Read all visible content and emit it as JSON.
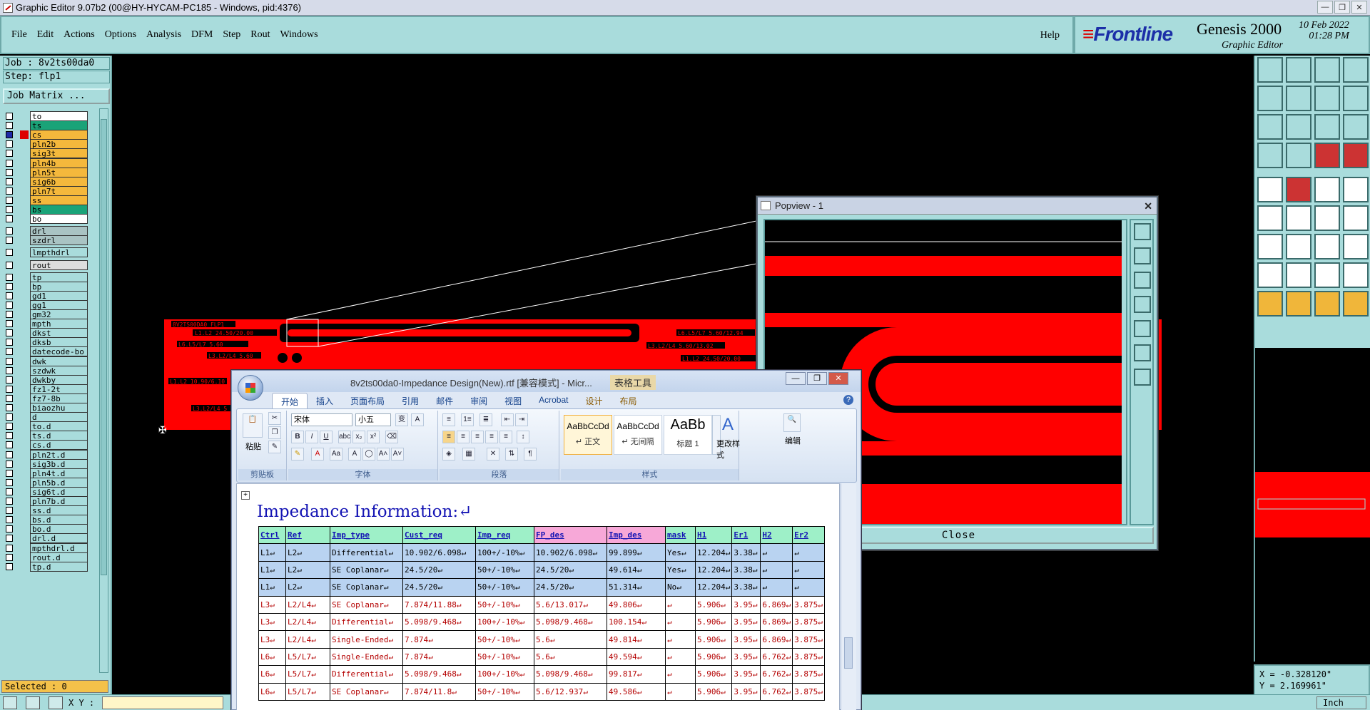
{
  "window": {
    "title": "Graphic Editor 9.07b2 (00@HY-HYCAM-PC185 - Windows, pid:4376)"
  },
  "menu": {
    "items": [
      "File",
      "Edit",
      "Actions",
      "Options",
      "Analysis",
      "DFM",
      "Step",
      "Rout",
      "Windows"
    ],
    "help": "Help"
  },
  "brand": {
    "logo": "Frontline",
    "product": "Genesis 2000",
    "subtitle": "Graphic Editor",
    "date": "10 Feb 2022",
    "time": "01:28 PM"
  },
  "job": {
    "job": "Job : 8v2ts00da0",
    "step": "Step: flp1",
    "matrix_button": "Job Matrix ...",
    "selected": "Selected : 0"
  },
  "layers": [
    {
      "name": "to",
      "color": "#ffffff"
    },
    {
      "name": "ts",
      "color": "#1aa378"
    },
    {
      "name": "cs",
      "color": "#f4b83c",
      "sel": true
    },
    {
      "name": "pln2b",
      "color": "#f4b83c"
    },
    {
      "name": "sig3t",
      "color": "#f4b83c"
    },
    {
      "name": "pln4b",
      "color": "#f4b83c"
    },
    {
      "name": "pln5t",
      "color": "#f4b83c"
    },
    {
      "name": "sig6b",
      "color": "#f4b83c"
    },
    {
      "name": "pln7t",
      "color": "#f4b83c"
    },
    {
      "name": "ss",
      "color": "#f4b83c"
    },
    {
      "name": "bs",
      "color": "#1aa378"
    },
    {
      "name": "bo",
      "color": "#ffffff"
    },
    {
      "name": "drl",
      "color": "#a9c3c3",
      "gap": true
    },
    {
      "name": "szdrl",
      "color": "#a9c3c3"
    },
    {
      "name": "lmpthdrl",
      "color": "#a9dcdc",
      "gap": true
    },
    {
      "name": "rout",
      "color": "#dddddd",
      "gap": true
    },
    {
      "name": "tp",
      "color": "#a9dcdc",
      "gap": true
    },
    {
      "name": "bp",
      "color": "#a9dcdc"
    },
    {
      "name": "gd1",
      "color": "#a9dcdc"
    },
    {
      "name": "gg1",
      "color": "#a9dcdc"
    },
    {
      "name": "gm32",
      "color": "#a9dcdc"
    },
    {
      "name": "mpth",
      "color": "#a9dcdc"
    },
    {
      "name": "dkst",
      "color": "#a9dcdc"
    },
    {
      "name": "dksb",
      "color": "#a9dcdc"
    },
    {
      "name": "datecode-bo",
      "color": "#a9dcdc"
    },
    {
      "name": "dwk",
      "color": "#a9dcdc"
    },
    {
      "name": "szdwk",
      "color": "#a9dcdc"
    },
    {
      "name": "dwkby",
      "color": "#a9dcdc"
    },
    {
      "name": "fz1-2t",
      "color": "#a9dcdc"
    },
    {
      "name": "fz7-8b",
      "color": "#a9dcdc"
    },
    {
      "name": "biaozhu",
      "color": "#a9dcdc"
    },
    {
      "name": "d",
      "color": "#a9dcdc"
    },
    {
      "name": "to.d",
      "color": "#a9dcdc"
    },
    {
      "name": "ts.d",
      "color": "#a9dcdc"
    },
    {
      "name": "cs.d",
      "color": "#a9dcdc"
    },
    {
      "name": "pln2t.d",
      "color": "#a9dcdc"
    },
    {
      "name": "sig3b.d",
      "color": "#a9dcdc"
    },
    {
      "name": "pln4t.d",
      "color": "#a9dcdc"
    },
    {
      "name": "pln5b.d",
      "color": "#a9dcdc"
    },
    {
      "name": "sig6t.d",
      "color": "#a9dcdc"
    },
    {
      "name": "pln7b.d",
      "color": "#a9dcdc"
    },
    {
      "name": "ss.d",
      "color": "#a9dcdc"
    },
    {
      "name": "bs.d",
      "color": "#a9dcdc"
    },
    {
      "name": "bo.d",
      "color": "#a9dcdc"
    },
    {
      "name": "drl.d",
      "color": "#a9dcdc"
    },
    {
      "name": "mpthdrl.d",
      "color": "#a9dcdc"
    },
    {
      "name": "rout.d",
      "color": "#a9dcdc"
    },
    {
      "name": "tp.d",
      "color": "#a9dcdc"
    }
  ],
  "board": {
    "label": "8V2TS00DA0 FLP1",
    "texts": [
      "L1.L2 24.50/20.00",
      "L6.L5/L7 5.60/12.94",
      "L6.L5/L7 5.60",
      "L3.L2/L4 5.60/13.02",
      "L3.L2/L4 5.60",
      "L1.L2 24.50/20.00",
      "L1.L2 10.90/6.10",
      "L3.L2/L4 5"
    ]
  },
  "popview": {
    "title": "Popview - 1",
    "close": "Close"
  },
  "status": {
    "xy_label": "X Y :",
    "units": "Inch",
    "x": "X = -0.328120\"",
    "y": "Y =  2.169961\""
  },
  "word": {
    "title": "8v2ts00da0-Impedance Design(New).rtf [兼容模式] - Micr...",
    "table_tools": "表格工具",
    "tabs": [
      "开始",
      "插入",
      "页面布局",
      "引用",
      "邮件",
      "审阅",
      "视图",
      "Acrobat",
      "设计",
      "布局"
    ],
    "font": "宋体",
    "size": "小五",
    "groups": {
      "clipboard": "剪贴板",
      "font": "字体",
      "paragraph": "段落",
      "styles": "样式",
      "edit": "编辑"
    },
    "paste": "粘贴",
    "change_styles": "更改样式",
    "edit_btn": "编辑",
    "styles": [
      {
        "preview": "AaBbCcDd",
        "name": "正文"
      },
      {
        "preview": "AaBbCcDd",
        "name": "无间隔"
      },
      {
        "preview": "AaBb",
        "name": "标题 1"
      }
    ],
    "heading": "Impedance Information:",
    "columns": [
      "Ctrl",
      "Ref",
      "Imp_type",
      "Cust_req",
      "Imp_req",
      "FP_des",
      "Imp_des",
      "mask",
      "H1",
      "Er1",
      "H2",
      "Er2"
    ],
    "rows": [
      {
        "hl": true,
        "cells": [
          "L1",
          "L2",
          "Differential",
          "10.902/6.098",
          "100+/-10%",
          "10.902/6.098",
          "99.899",
          "Yes",
          "12.204",
          "3.38",
          "",
          ""
        ]
      },
      {
        "hl": true,
        "cells": [
          "L1",
          "L2",
          "SE Coplanar",
          "24.5/20",
          "50+/-10%",
          "24.5/20",
          "49.614",
          "Yes",
          "12.204",
          "3.38",
          "",
          ""
        ]
      },
      {
        "hl": true,
        "cells": [
          "L1",
          "L2",
          "SE Coplanar",
          "24.5/20",
          "50+/-10%",
          "24.5/20",
          "51.314",
          "No",
          "12.204",
          "3.38",
          "",
          ""
        ]
      },
      {
        "hl": false,
        "cells": [
          "L3",
          "L2/L4",
          "SE Coplanar",
          "7.874/11.88",
          "50+/-10%",
          "5.6/13.017",
          "49.806",
          "",
          "5.906",
          "3.95",
          "6.869",
          "3.875"
        ]
      },
      {
        "hl": false,
        "cells": [
          "L3",
          "L2/L4",
          "Differential",
          "5.098/9.468",
          "100+/-10%",
          "5.098/9.468",
          "100.154",
          "",
          "5.906",
          "3.95",
          "6.869",
          "3.875"
        ]
      },
      {
        "hl": false,
        "cells": [
          "L3",
          "L2/L4",
          "Single-Ended",
          "7.874",
          "50+/-10%",
          "5.6",
          "49.814",
          "",
          "5.906",
          "3.95",
          "6.869",
          "3.875"
        ]
      },
      {
        "hl": false,
        "cells": [
          "L6",
          "L5/L7",
          "Single-Ended",
          "7.874",
          "50+/-10%",
          "5.6",
          "49.594",
          "",
          "5.906",
          "3.95",
          "6.762",
          "3.875"
        ]
      },
      {
        "hl": false,
        "cells": [
          "L6",
          "L5/L7",
          "Differential",
          "5.098/9.468",
          "100+/-10%",
          "5.098/9.468",
          "99.817",
          "",
          "5.906",
          "3.95",
          "6.762",
          "3.875"
        ]
      },
      {
        "hl": false,
        "cells": [
          "L6",
          "L5/L7",
          "SE Coplanar",
          "7.874/11.8",
          "50+/-10%",
          "5.6/12.937",
          "49.586",
          "",
          "5.906",
          "3.95",
          "6.762",
          "3.875"
        ]
      }
    ]
  },
  "colors": {
    "panel": "#a9dcdc",
    "board": "#ff0000",
    "highlight_row": "#b9d3f1",
    "data_text": "#b40000",
    "header_text": "#1414b4"
  }
}
